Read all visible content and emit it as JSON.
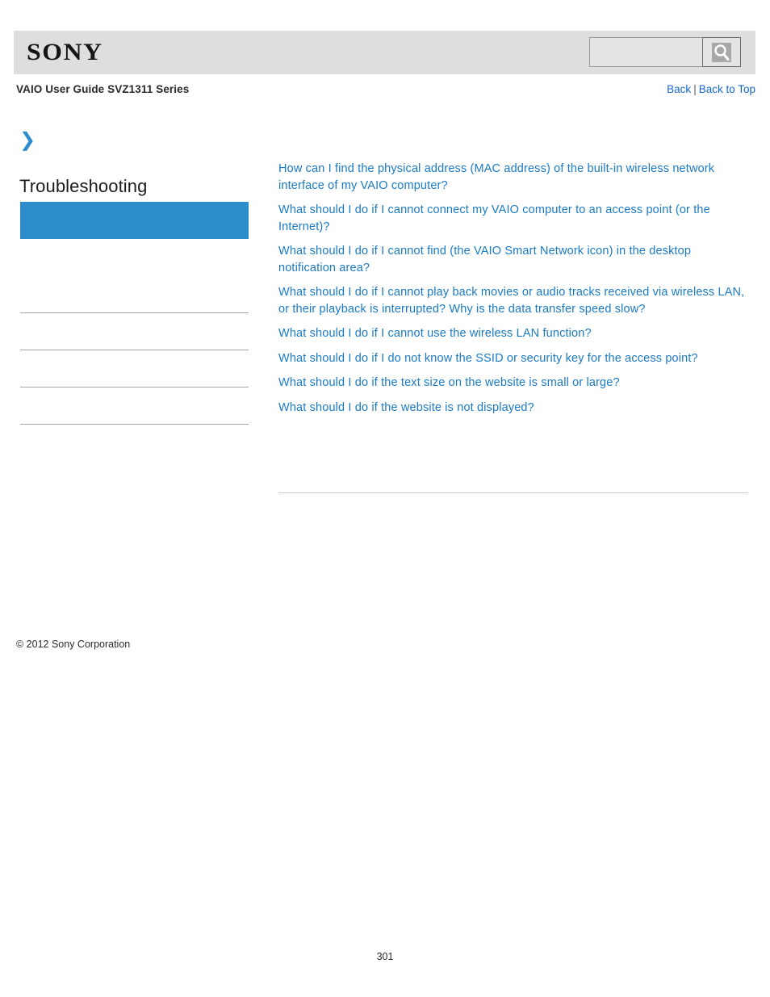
{
  "header": {
    "logo_text": "SONY",
    "search": {
      "value": "",
      "placeholder": "",
      "icon": "search-icon"
    }
  },
  "subheader": {
    "guide_title": "VAIO User Guide SVZ1311 Series",
    "back_label": "Back",
    "separator": "|",
    "back_to_top_label": "Back to Top"
  },
  "sidebar": {
    "expand_icon": "double-chevron-right-icon",
    "section_title": "Troubleshooting",
    "accent_color": "#2d8ccb",
    "items": [
      {
        "label": "",
        "selected": true
      },
      {
        "label": "",
        "selected": false
      },
      {
        "label": "",
        "selected": false
      },
      {
        "label": "",
        "selected": false
      },
      {
        "label": "",
        "selected": false
      },
      {
        "label": "",
        "selected": false
      }
    ]
  },
  "main": {
    "link_color": "#1a7ac4",
    "links": [
      "How can I find the physical address (MAC address) of the built-in wireless network interface of my VAIO computer?",
      "What should I do if I cannot connect my VAIO computer to an access point (or the Internet)?",
      "What should I do if I cannot find (the VAIO Smart Network icon) in the desktop notification area?",
      "What should I do if I cannot play back movies or audio tracks received via wireless LAN, or their playback is interrupted? Why is the data transfer speed slow?",
      "What should I do if I cannot use the wireless LAN function?",
      "What should I do if I do not know the SSID or security key for the access point?",
      "What should I do if the text size on the website is small or large?",
      "What should I do if the website is not displayed?"
    ]
  },
  "footer": {
    "copyright": "© 2012 Sony Corporation",
    "page_number": "301"
  }
}
